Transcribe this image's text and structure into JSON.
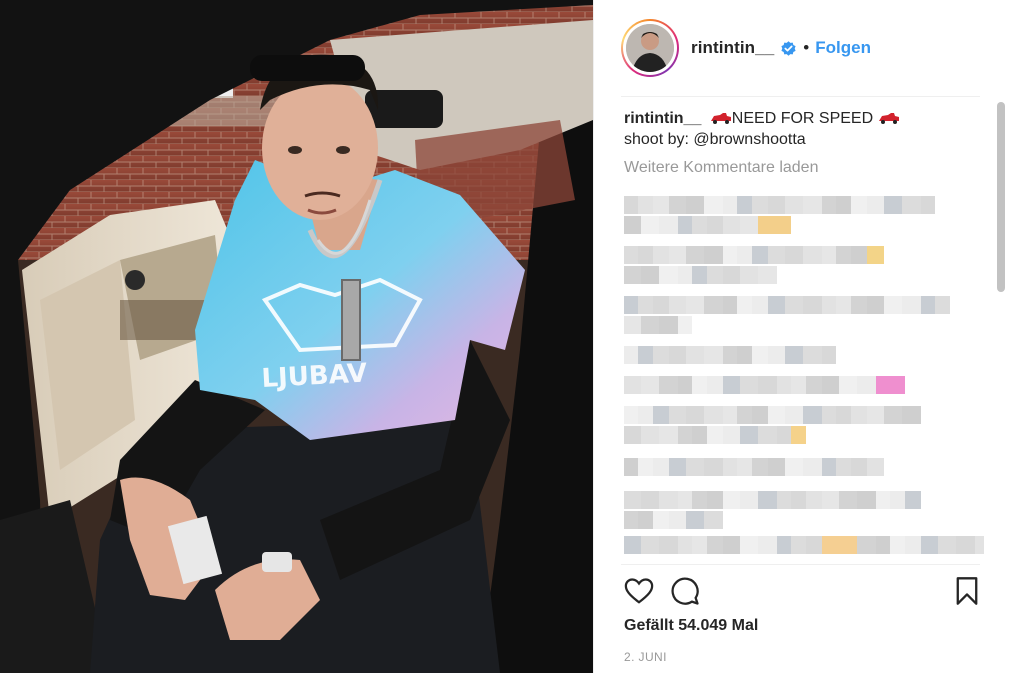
{
  "post": {
    "username": "rintintin__",
    "verified": true,
    "separator": "•",
    "follow_label": "Folgen"
  },
  "caption": {
    "username": "rintintin__",
    "text_main": "NEED FOR SPEED",
    "text_line2": "shoot by: @brownshootta",
    "emoji": "racing-car-emoji"
  },
  "comments": {
    "load_more_label": "Weitere Kommentare laden",
    "blurred": true
  },
  "photo": {
    "subject": "man in tie-dye LJUBAV t-shirt sitting in open car door",
    "shirt_print": "LJUBAV"
  },
  "actions": {
    "like_icon": "heart-icon",
    "comment_icon": "comment-icon",
    "save_icon": "bookmark-icon"
  },
  "stats": {
    "likes_label": "Gefällt 54.049 Mal",
    "date_label": "2. JUNI"
  },
  "colors": {
    "accent": "#3897f0",
    "muted": "#999999",
    "text": "#262626",
    "border": "#efefef"
  }
}
